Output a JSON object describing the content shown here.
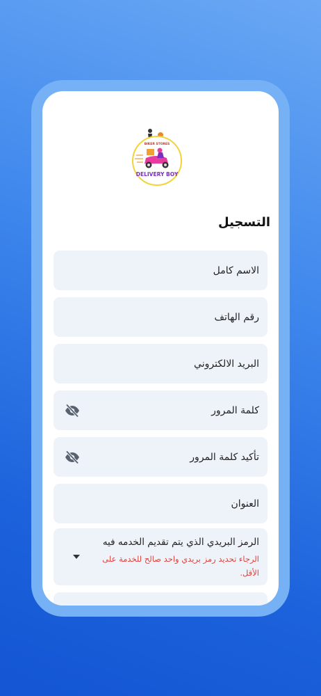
{
  "logo": {
    "top_text": "BIKER STORES",
    "main_text": "DELIVERY BOY"
  },
  "page_title": "التسجيل",
  "fields": {
    "full_name": "الاسم كامل",
    "phone": "رقم الهاتف",
    "email": "البريد الالكتروني",
    "password": "كلمة المرور",
    "confirm_password": "تأكيد كلمة المرور",
    "address": "العنوان",
    "zip_label": "الرمز البريدي الذي يتم تقديم الخدمه فيه",
    "zip_error": "الرجاء تحديد رمز بريدي واحد صالح للخدمة على الأقل."
  },
  "icons": {
    "password_toggle": "eye-off-icon",
    "dropdown": "caret-down-icon"
  },
  "colors": {
    "background_gradient": [
      "#6aa8f4",
      "#1355d3"
    ],
    "field_bg": "#eef2f9",
    "error": "#e0433b",
    "logo_ring": "#f2d43a",
    "logo_text": "#7a2fbf",
    "scooter": "#e83aa0"
  }
}
